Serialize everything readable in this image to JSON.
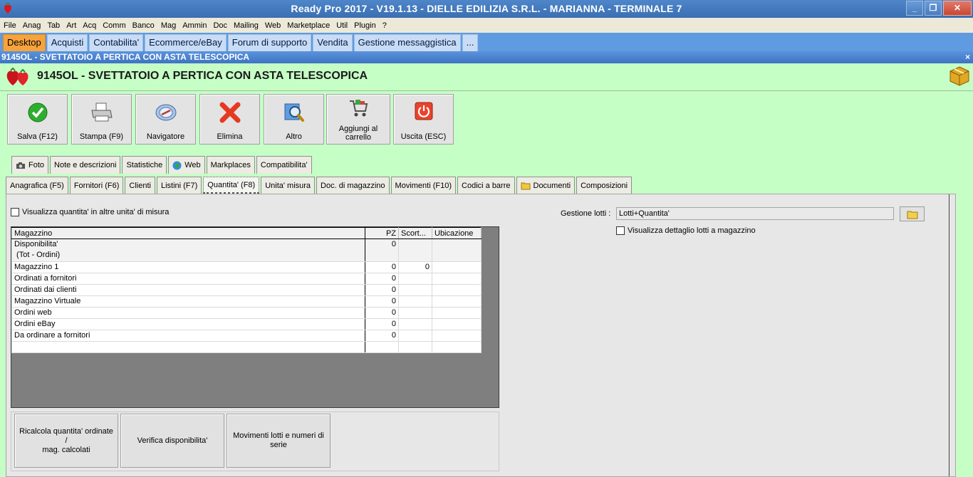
{
  "window": {
    "title": "Ready Pro 2017 - V19.1.13 - DIELLE EDILIZIA S.R.L. - MARIANNA - TERMINALE 7",
    "controls": [
      "_",
      "❐",
      "✕"
    ]
  },
  "menu": [
    "File",
    "Anag",
    "Tab",
    "Art",
    "Acq",
    "Comm",
    "Banco",
    "Mag",
    "Ammin",
    "Doc",
    "Mailing",
    "Web",
    "Marketplace",
    "Util",
    "Plugin",
    "?"
  ],
  "module_tabs": [
    "Desktop",
    "Acquisti",
    "Contabilita'",
    "Ecommerce/eBay",
    "Forum di supporto",
    "Vendita",
    "Gestione messaggistica",
    "..."
  ],
  "document": {
    "bar_title": "9145OL - SVETTATOIO A PERTICA CON ASTA TELESCOPICA",
    "close": "×",
    "heading": "9145OL - SVETTATOIO A PERTICA CON ASTA TELESCOPICA"
  },
  "toolbar": {
    "save": "Salva (F12)",
    "print": "Stampa (F9)",
    "navigator": "Navigatore",
    "delete": "Elimina",
    "other": "Altro",
    "add_cart_1": "Aggiungi al",
    "add_cart_2": "carrello",
    "exit": "Uscita (ESC)"
  },
  "tabs_top": [
    "Foto",
    "Note e descrizioni",
    "Statistiche",
    "Web",
    "Markplaces",
    "Compatibilita'"
  ],
  "tabs_bottom": [
    "Anagrafica (F5)",
    "Fornitori (F6)",
    "Clienti",
    "Listini (F7)",
    "Quantita' (F8)",
    "Unita' misura",
    "Doc. di magazzino",
    "Movimenti (F10)",
    "Codici a barre",
    "Documenti",
    "Composizioni"
  ],
  "qty": {
    "show_other_units": "Visualizza quantita' in altre unita' di misura",
    "columns": [
      "Magazzino",
      "PZ",
      "Scort...",
      "Ubicazione"
    ],
    "rows": [
      {
        "name_1": "Disponibilita'",
        "name_2": " (Tot - Ordini)",
        "pz": "0",
        "scort": "",
        "ubic": ""
      },
      {
        "name_1": "Magazzino 1",
        "pz": "0",
        "scort": "0",
        "ubic": ""
      },
      {
        "name_1": "Ordinati a fornitori",
        "pz": "0",
        "scort": "",
        "ubic": ""
      },
      {
        "name_1": "Ordinati dai clienti",
        "pz": "0",
        "scort": "",
        "ubic": ""
      },
      {
        "name_1": "Magazzino Virtuale",
        "pz": "0",
        "scort": "",
        "ubic": ""
      },
      {
        "name_1": "Ordini web",
        "pz": "0",
        "scort": "",
        "ubic": ""
      },
      {
        "name_1": "Ordini eBay",
        "pz": "0",
        "scort": "",
        "ubic": ""
      },
      {
        "name_1": "Da ordinare a fornitori",
        "pz": "0",
        "scort": "",
        "ubic": ""
      }
    ],
    "btn_recalc_1": "Ricalcola quantita' ordinate /",
    "btn_recalc_2": "mag. calcolati",
    "btn_verify": "Verifica disponibilita'",
    "btn_lots_1": "Movimenti lotti e numeri di",
    "btn_lots_2": "serie"
  },
  "lots": {
    "label": "Gestione lotti :",
    "value": "Lotti+Quantita'",
    "show_detail": "Visualizza dettaglio lotti a magazzino"
  },
  "colors": {
    "accent_tab": "#f7a33d",
    "panel_bg": "#c6ffc6",
    "titlebar": "#3a6fb2"
  }
}
